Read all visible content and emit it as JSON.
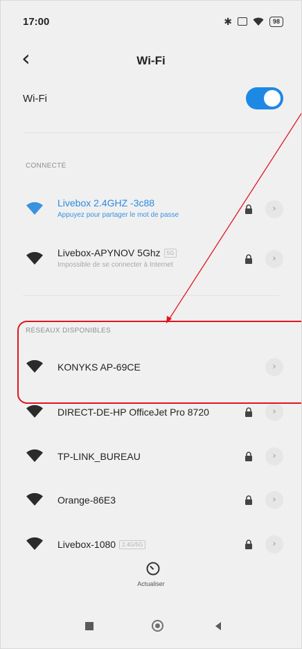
{
  "status": {
    "time": "17:00",
    "battery": "98"
  },
  "header": {
    "title": "Wi-Fi"
  },
  "wifi_toggle": {
    "label": "Wi-Fi",
    "enabled": true
  },
  "sections": {
    "connected_label": "CONNECTÉ",
    "available_label": "RÉSEAUX DISPONIBLES"
  },
  "connected_networks": [
    {
      "name": "Livebox 2.4GHZ -3c88",
      "subtitle": "Appuyez pour partager le mot de passe",
      "badge": "",
      "secured": true,
      "active": true
    },
    {
      "name": "Livebox-APYNOV 5Ghz",
      "subtitle": "Impossible de se connecter à Internet",
      "badge": "5G",
      "secured": true,
      "active": false
    }
  ],
  "available_networks": [
    {
      "name": "KONYKS AP-69CE",
      "badge": "",
      "secured": false
    },
    {
      "name": "DIRECT-DE-HP OfficeJet Pro 8720",
      "badge": "",
      "secured": true
    },
    {
      "name": "TP-LINK_BUREAU",
      "badge": "",
      "secured": true
    },
    {
      "name": "Orange-86E3",
      "badge": "",
      "secured": true
    },
    {
      "name": "Livebox-1080",
      "badge": "2.4G/5G",
      "secured": true
    }
  ],
  "refresh": {
    "label": "Actualiser"
  },
  "colors": {
    "accent": "#1e88e5",
    "active_text": "#2a8ae0",
    "annotation": "#e0141e"
  },
  "icons": {
    "back": "back-arrow-icon",
    "wifi": "wifi-signal-icon",
    "lock": "lock-icon",
    "chevron": "chevron-right-icon",
    "refresh": "refresh-icon"
  }
}
